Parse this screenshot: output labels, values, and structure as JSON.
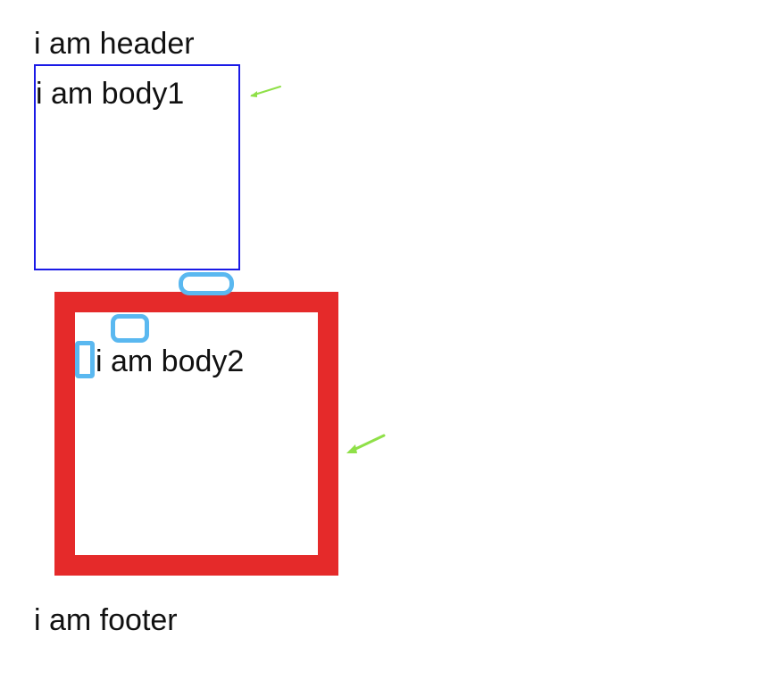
{
  "header": {
    "text": "i am header"
  },
  "body1": {
    "text": "i am body1"
  },
  "body2": {
    "text": "i am body2"
  },
  "footer": {
    "text": "i am footer"
  },
  "colors": {
    "body1_border": "#1a1ae6",
    "body2_border": "#e52a2a",
    "marker": "#5ab8f0",
    "arrow": "#8fe048"
  },
  "annotations": {
    "arrows": [
      "arrow-icon",
      "arrow-icon"
    ],
    "markers": [
      "margin-marker",
      "padding-marker",
      "padding-marker"
    ]
  }
}
